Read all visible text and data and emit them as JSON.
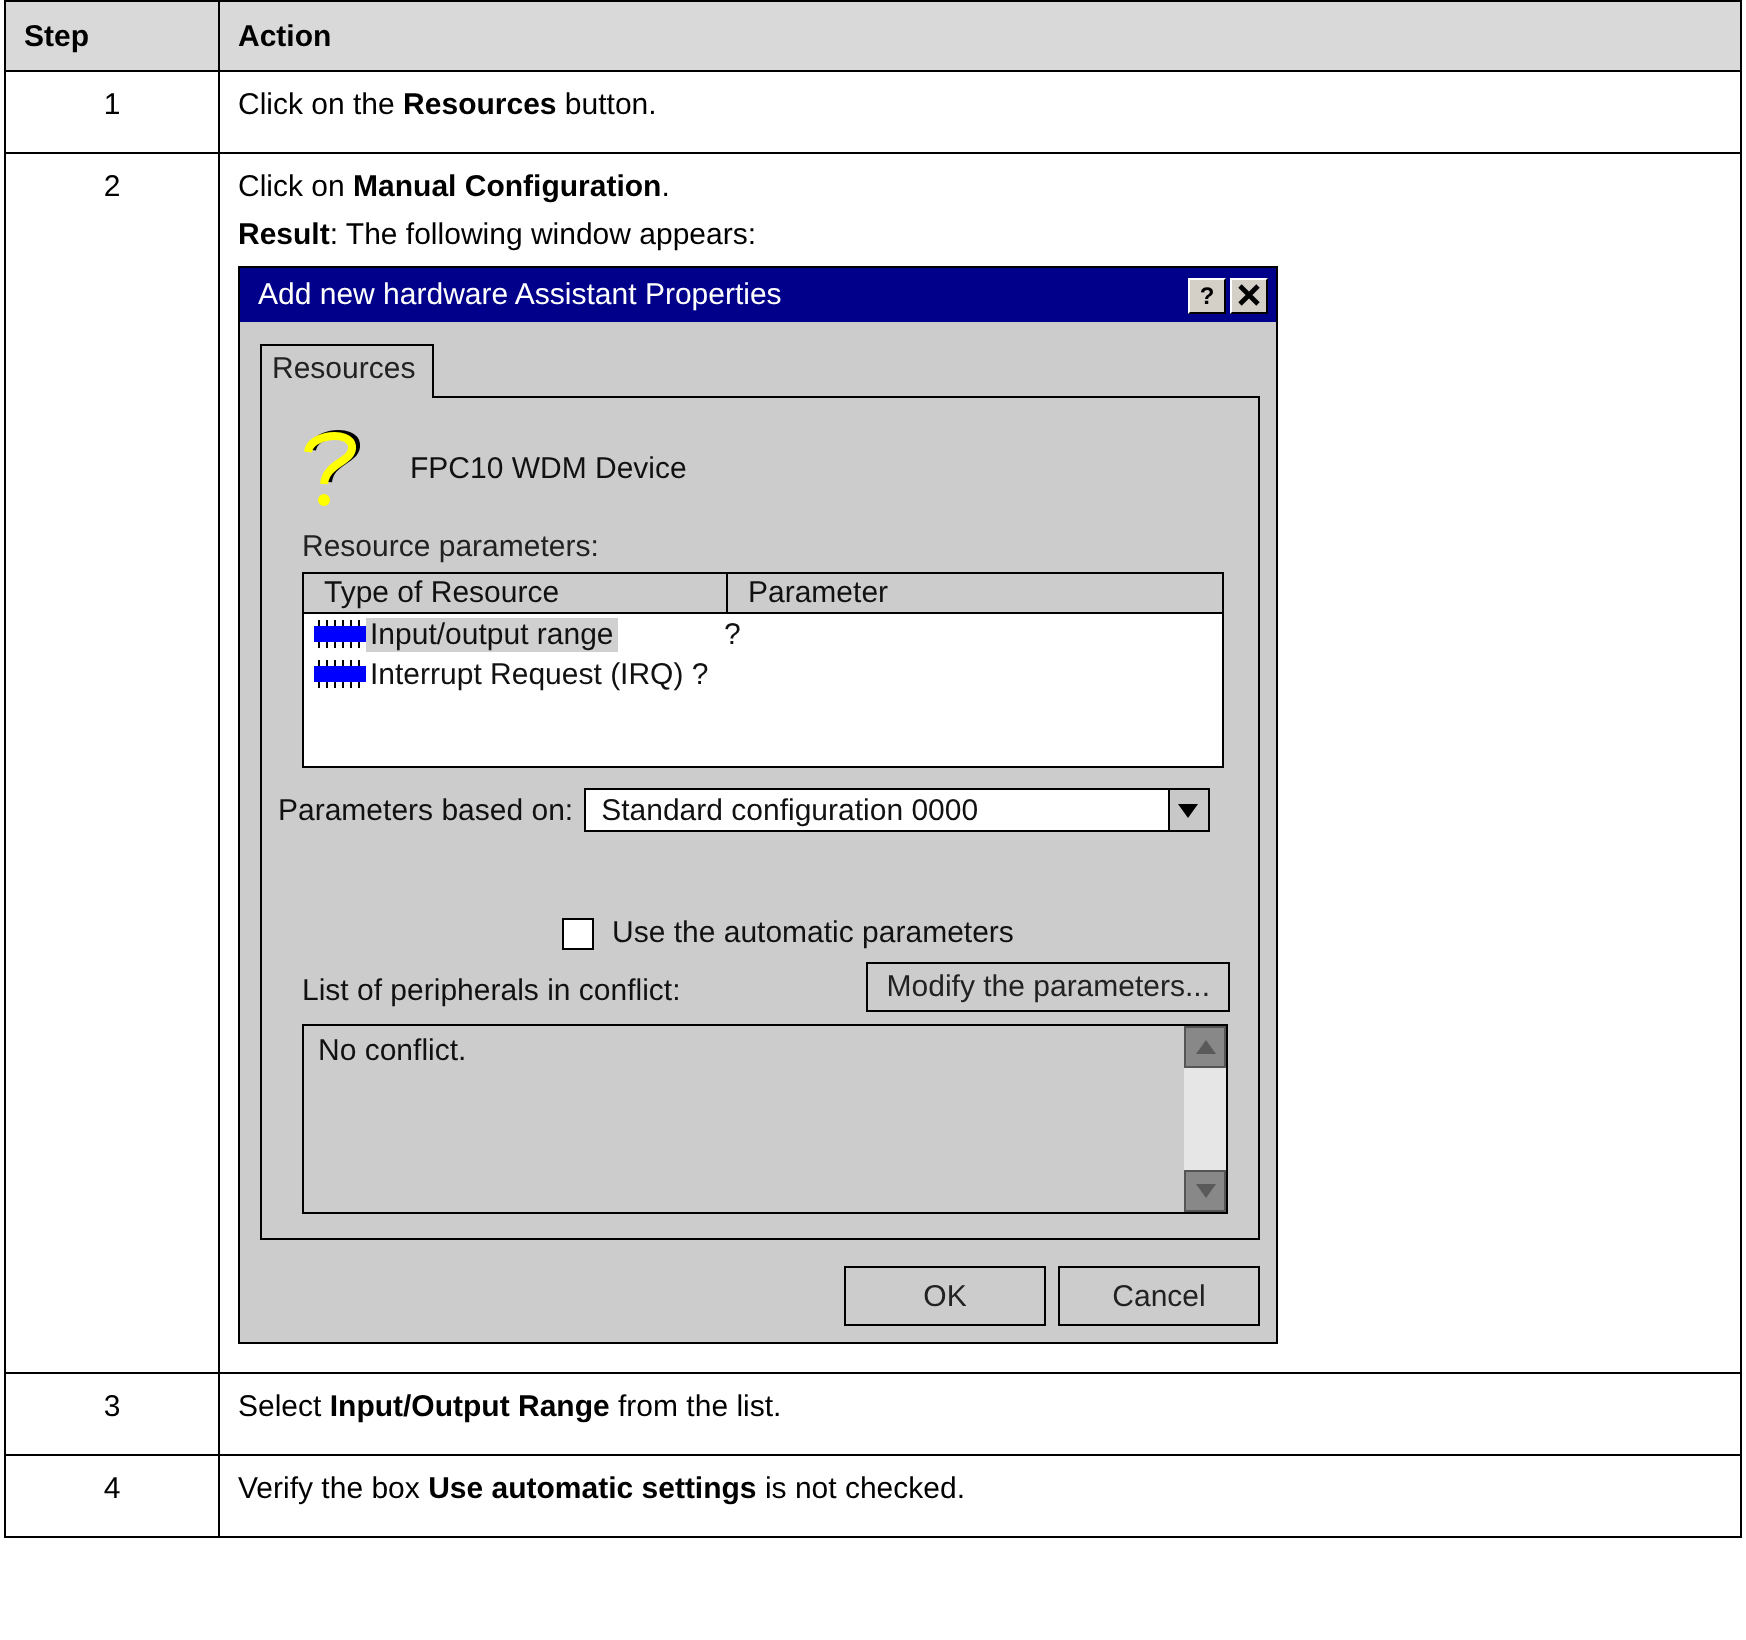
{
  "table": {
    "columns": [
      "Step",
      "Action"
    ],
    "rows": [
      {
        "step": "1",
        "action": "Click on the **Resources** button."
      },
      {
        "step": "2",
        "action": "Click on **Manual Configuration**.",
        "result": "**Result**: The following window appears:",
        "dialog": {
          "title": "Add new hardware Assistant Properties",
          "help_button": "?",
          "tabs": [
            {
              "label": "Resources",
              "selected": true
            }
          ],
          "device_name": "FPC10 WDM Device",
          "resource_label": "Resource parameters:",
          "list_columns": [
            "Type of Resource",
            "Parameter"
          ],
          "list_rows": [
            {
              "type": "Input/output range",
              "parameter": "?",
              "selected": true
            },
            {
              "type": "Interrupt Request (IRQ) ?",
              "selected": false
            }
          ],
          "params_label": "Parameters based on:",
          "params_value": "Standard configuration 0000",
          "checkbox": {
            "label": "Use the automatic parameters",
            "checked": false
          },
          "conflict_label": "List of peripherals in conflict:",
          "modify_button": "Modify the parameters...",
          "conflict_items": [
            "No conflict."
          ],
          "buttons": [
            "OK",
            "Cancel"
          ]
        }
      },
      {
        "step": "3",
        "action": "Select **Input/Output Range** from the list."
      },
      {
        "step": "4",
        "action": "Verify the box **Use automatic settings** is not checked."
      }
    ]
  }
}
